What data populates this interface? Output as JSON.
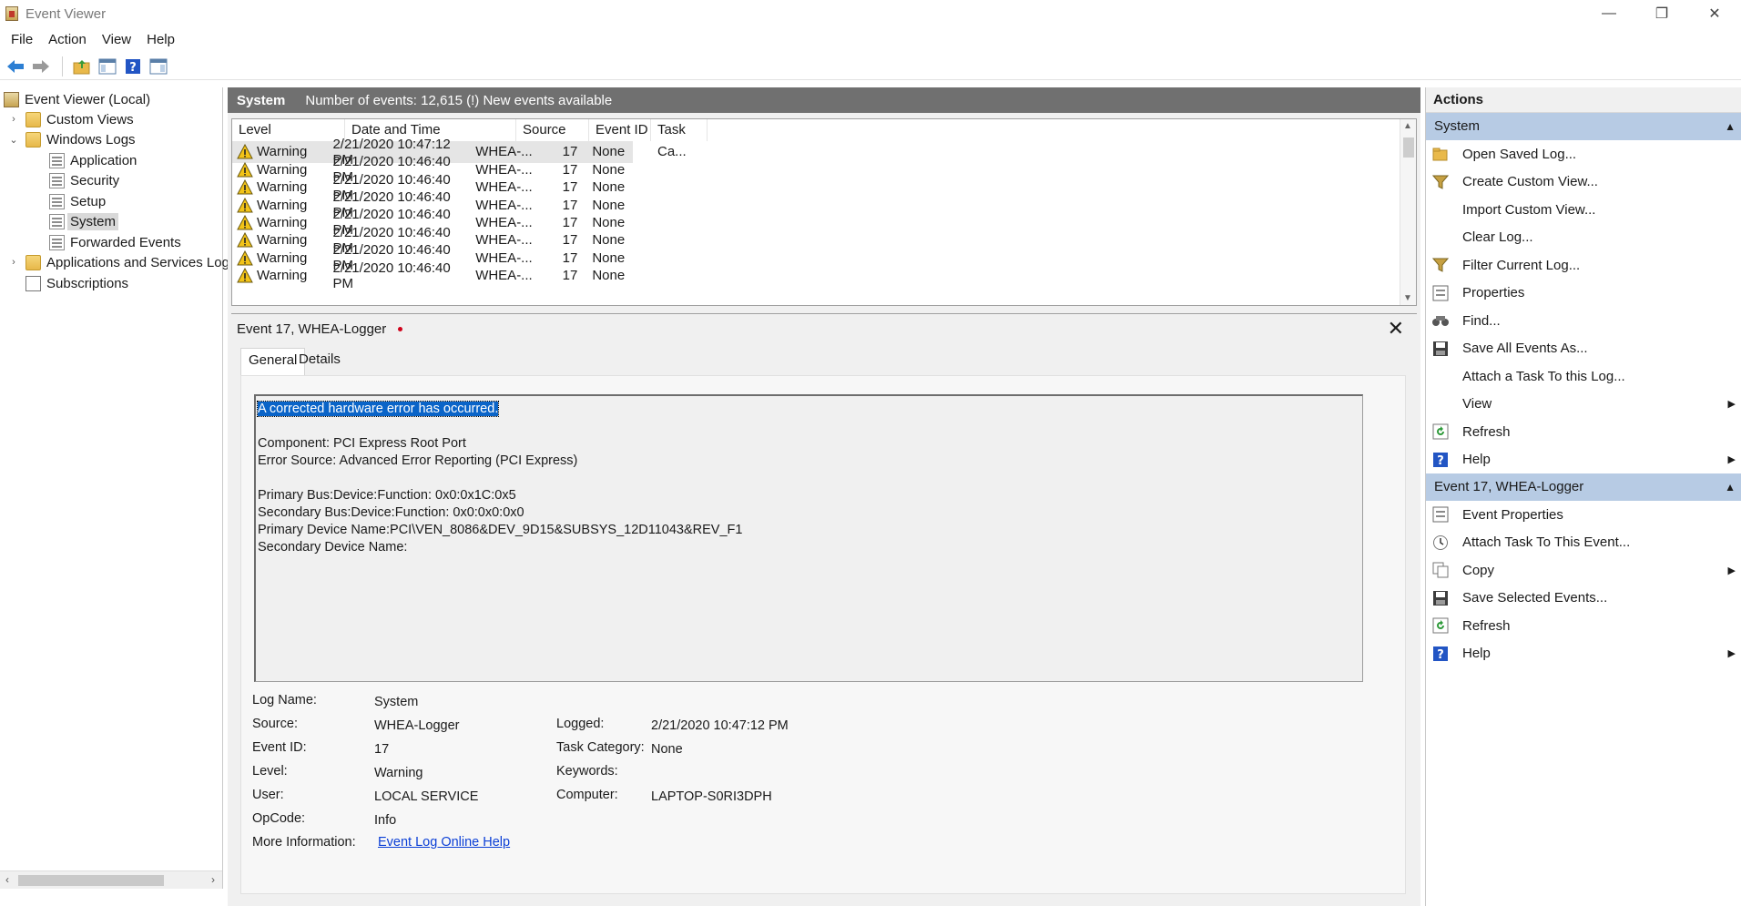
{
  "window": {
    "title": "Event Viewer"
  },
  "menu": [
    "File",
    "Action",
    "View",
    "Help"
  ],
  "tree": {
    "root": "Event Viewer (Local)",
    "custom_views": "Custom Views",
    "windows_logs": "Windows Logs",
    "application": "Application",
    "security": "Security",
    "setup": "Setup",
    "system": "System",
    "forwarded": "Forwarded Events",
    "apps_services": "Applications and Services Log",
    "subscriptions": "Subscriptions"
  },
  "log_header": {
    "name": "System",
    "info": "Number of events: 12,615 (!) New events available"
  },
  "columns": {
    "level": "Level",
    "date": "Date and Time",
    "source": "Source",
    "event_id": "Event ID",
    "task": "Task Ca..."
  },
  "events": [
    {
      "level": "Warning",
      "date": "2/21/2020 10:47:12 PM",
      "source": "WHEA-...",
      "id": "17",
      "task": "None"
    },
    {
      "level": "Warning",
      "date": "2/21/2020 10:46:40 PM",
      "source": "WHEA-...",
      "id": "17",
      "task": "None"
    },
    {
      "level": "Warning",
      "date": "2/21/2020 10:46:40 PM",
      "source": "WHEA-...",
      "id": "17",
      "task": "None"
    },
    {
      "level": "Warning",
      "date": "2/21/2020 10:46:40 PM",
      "source": "WHEA-...",
      "id": "17",
      "task": "None"
    },
    {
      "level": "Warning",
      "date": "2/21/2020 10:46:40 PM",
      "source": "WHEA-...",
      "id": "17",
      "task": "None"
    },
    {
      "level": "Warning",
      "date": "2/21/2020 10:46:40 PM",
      "source": "WHEA-...",
      "id": "17",
      "task": "None"
    },
    {
      "level": "Warning",
      "date": "2/21/2020 10:46:40 PM",
      "source": "WHEA-...",
      "id": "17",
      "task": "None"
    },
    {
      "level": "Warning",
      "date": "2/21/2020 10:46:40 PM",
      "source": "WHEA-...",
      "id": "17",
      "task": "None"
    }
  ],
  "detail": {
    "title": "Event 17, WHEA-Logger",
    "tabs": {
      "general": "General",
      "details": "Details"
    },
    "description": {
      "highlight": "A corrected hardware error has occurred.",
      "component": "Component: PCI Express Root Port",
      "error_source": "Error Source: Advanced Error Reporting (PCI Express)",
      "primary_bus": "Primary Bus:Device:Function: 0x0:0x1C:0x5",
      "secondary_bus": "Secondary Bus:Device:Function: 0x0:0x0:0x0",
      "primary_device": "Primary Device Name:PCI\\VEN_8086&DEV_9D15&SUBSYS_12D11043&REV_F1",
      "secondary_device": "Secondary Device Name:"
    },
    "labels": {
      "log_name": "Log Name:",
      "source": "Source:",
      "event_id": "Event ID:",
      "level": "Level:",
      "user": "User:",
      "opcode": "OpCode:",
      "more_info": "More Information:",
      "logged": "Logged:",
      "task_category": "Task Category:",
      "keywords": "Keywords:",
      "computer": "Computer:"
    },
    "values": {
      "log_name": "System",
      "source": "WHEA-Logger",
      "event_id": "17",
      "level": "Warning",
      "user": "LOCAL SERVICE",
      "opcode": "Info",
      "more_info": "Event Log Online Help",
      "logged": "2/21/2020 10:47:12 PM",
      "task_category": "None",
      "keywords": "",
      "computer": "LAPTOP-S0RI3DPH"
    }
  },
  "actions": {
    "title": "Actions",
    "section1": "System",
    "items1": [
      "Open Saved Log...",
      "Create Custom View...",
      "Import Custom View...",
      "Clear Log...",
      "Filter Current Log...",
      "Properties",
      "Find...",
      "Save All Events As...",
      "Attach a Task To this Log...",
      "View",
      "Refresh",
      "Help"
    ],
    "section2": "Event 17, WHEA-Logger",
    "items2": [
      "Event Properties",
      "Attach Task To This Event...",
      "Copy",
      "Save Selected Events...",
      "Refresh",
      "Help"
    ]
  },
  "colors": {
    "selection": "#0a64c8",
    "section_header": "#b7cbe4",
    "log_header_bg": "#707070",
    "link": "#0b3fd6"
  }
}
